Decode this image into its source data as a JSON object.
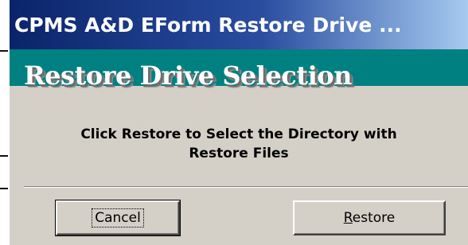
{
  "window": {
    "title": "CPMS A&D EForm Restore Drive ..."
  },
  "banner": {
    "title": "Restore Drive Selection"
  },
  "instruction": {
    "line1": "Click Restore to Select the Directory with",
    "line2": "Restore Files"
  },
  "buttons": {
    "cancel_label": "Cancel",
    "restore_accel": "R",
    "restore_rest": "estore"
  },
  "colors": {
    "title_bar": "#0a246a",
    "banner": "#008080",
    "dialog_face": "#d4d0c8"
  }
}
